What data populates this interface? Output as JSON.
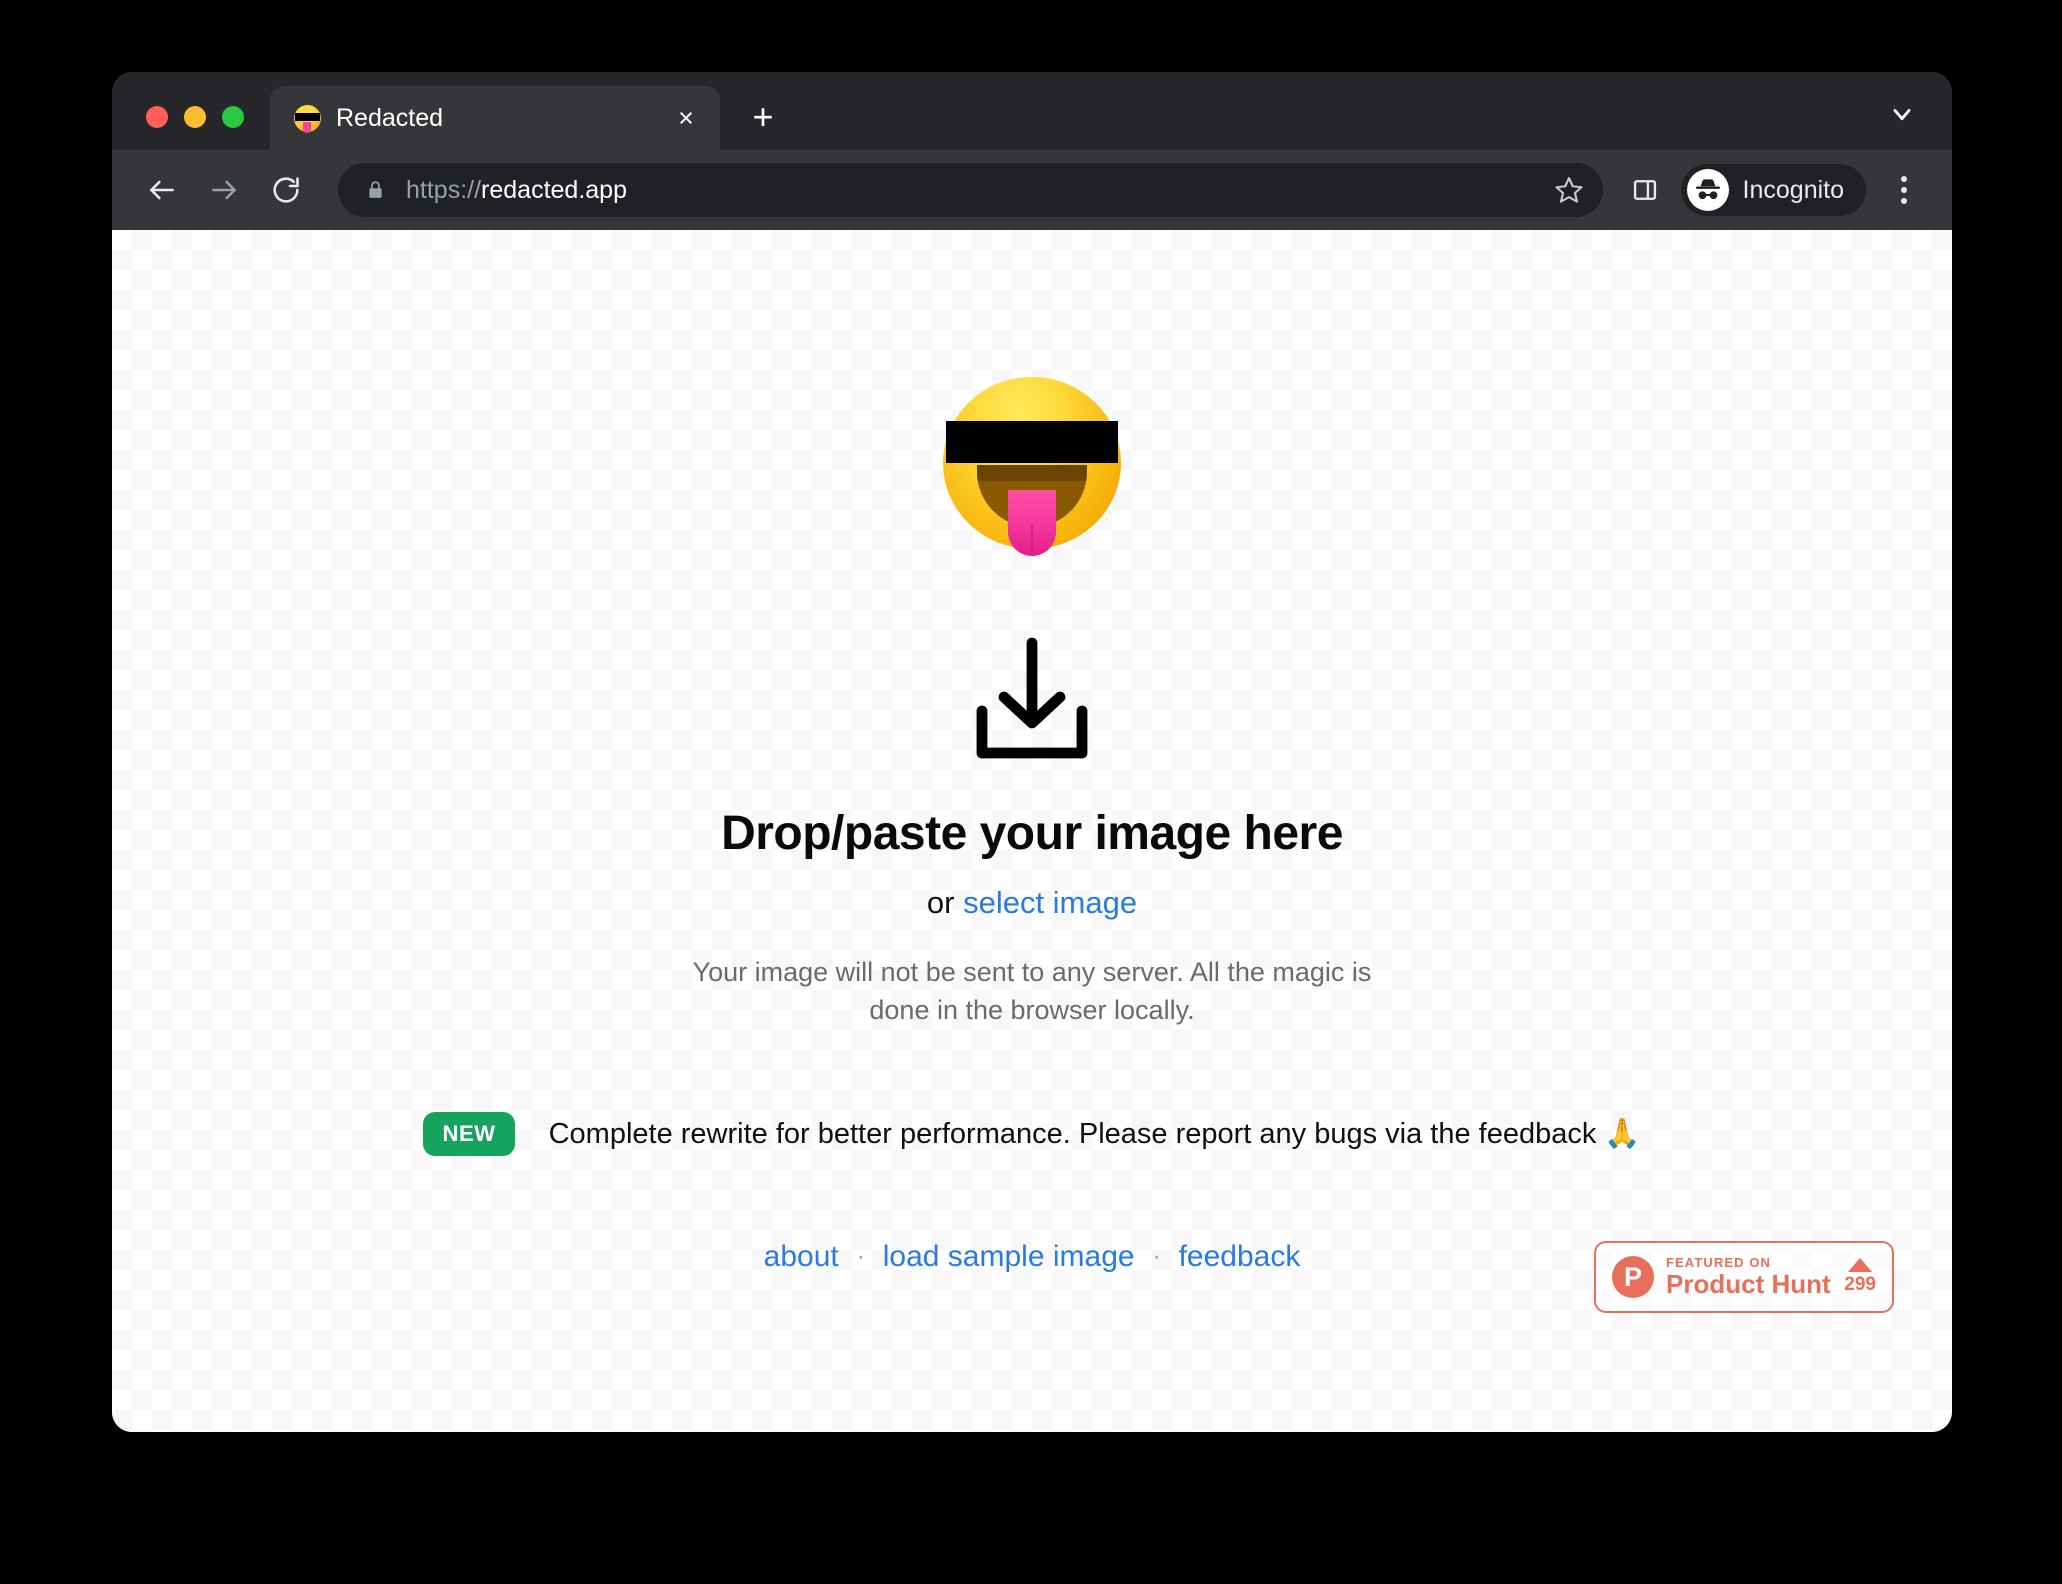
{
  "window": {
    "traffic_lights": [
      "close",
      "minimize",
      "maximize"
    ]
  },
  "tab_strip": {
    "tab": {
      "title": "Redacted",
      "favicon": "redacted-face-emoji",
      "close_label": "×"
    },
    "new_tab_label": "+",
    "tab_list_icon": "chevron-down-icon"
  },
  "toolbar": {
    "back_icon": "arrow-left-icon",
    "forward_icon": "arrow-right-icon",
    "reload_icon": "reload-icon",
    "lock_icon": "lock-icon",
    "url_scheme": "https://",
    "url_host": "redacted.app",
    "star_icon": "star-icon",
    "side_panel_icon": "side-panel-icon",
    "incognito_label": "Incognito",
    "incognito_icon": "incognito-hat-glasses-icon",
    "menu_icon": "three-dot-menu-icon"
  },
  "page": {
    "hero_emoji": "face-with-tongue-and-black-redaction-bar",
    "drop_icon": "download-tray-icon",
    "headline": "Drop/paste your image here",
    "sub_prefix": "or ",
    "sub_link": "select image",
    "description_line_1": "Your image will not be sent to any server. All the magic is",
    "description_line_2": "done in the browser locally.",
    "announcement": {
      "badge": "NEW",
      "text": "Complete rewrite for better performance. Please report any bugs via the feedback 🙏"
    },
    "footer_links": [
      {
        "label": "about"
      },
      {
        "label": "load sample image"
      },
      {
        "label": "feedback"
      }
    ],
    "separator": "·",
    "product_hunt": {
      "featured_on": "FEATURED ON",
      "name": "Product Hunt",
      "logo_letter": "P",
      "upvote_icon": "upvote-triangle-icon",
      "count": "299"
    }
  },
  "colors": {
    "link": "#2a7ae2",
    "new_badge": "#16a35d",
    "product_hunt": "#e8705a",
    "chrome_dark": "#26272b",
    "toolbar": "#35363a"
  }
}
